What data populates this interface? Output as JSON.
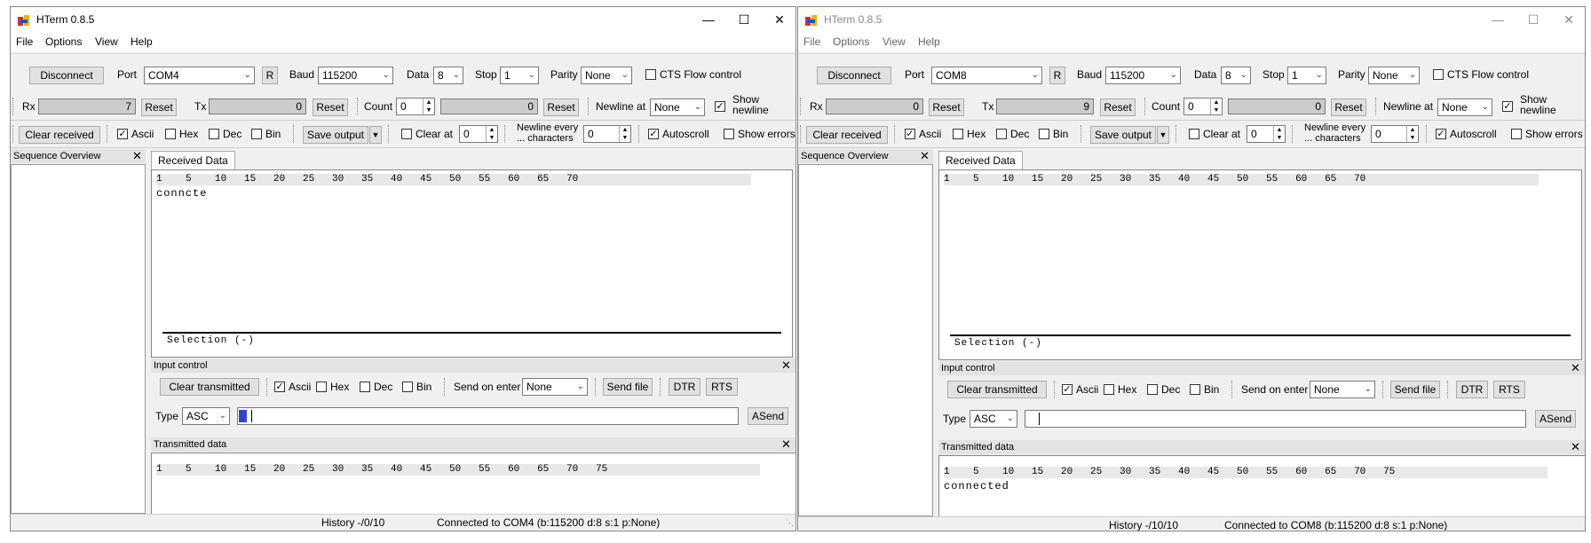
{
  "windows": [
    {
      "title": "HTerm 0.8.5",
      "menus": [
        "File",
        "Options",
        "View",
        "Help"
      ],
      "disconnect_label": "Disconnect",
      "port_label": "Port",
      "port_value": "COM4",
      "r_label": "R",
      "baud_label": "Baud",
      "baud_value": "115200",
      "data_label": "Data",
      "data_value": "8",
      "stop_label": "Stop",
      "stop_value": "1",
      "parity_label": "Parity",
      "parity_value": "None",
      "cts_label": "CTS Flow control",
      "rx_label": "Rx",
      "rx_value": "7",
      "tx_label": "Tx",
      "tx_value": "0",
      "reset_label": "Reset",
      "count_label": "Count",
      "count_value": "0",
      "count_field": "0",
      "newline_at_label": "Newline at",
      "newline_at_value": "None",
      "show_newline_label1": "Show",
      "show_newline_label2": "newline",
      "clear_received_label": "Clear received",
      "ascii_label": "Ascii",
      "hex_label": "Hex",
      "dec_label": "Dec",
      "bin_label": "Bin",
      "save_output_label": "Save output",
      "clear_at_label": "Clear at",
      "clear_at_value": "0",
      "newline_every_label1": "Newline every",
      "newline_every_label2": "... characters",
      "newline_every_value": "0",
      "autoscroll_label": "Autoscroll",
      "show_errors_label": "Show errors",
      "sequence_overview_label": "Sequence Overview",
      "received_tab_label": "Received Data",
      "ruler_recv": "1    5    10   15   20   25   30   35   40   45   50   55   60   65   70",
      "received_text": "conncte",
      "selection_label": "Selection (-)",
      "input_control_label": "Input control",
      "clear_transmitted_label": "Clear transmitted",
      "send_on_enter_label": "Send on enter",
      "send_on_enter_value": "None",
      "send_file_label": "Send file",
      "dtr_label": "DTR",
      "rts_label": "RTS",
      "type_label": "Type",
      "type_value": "ASC",
      "asend_label": "ASend",
      "transmitted_label": "Transmitted data",
      "ruler_tx": "1    5    10   15   20   25   30   35   40   45   50   55   60   65   70   75",
      "transmitted_text": "",
      "history_label": "History -/0/10",
      "status_label": "Connected to COM4 (b:115200 d:8 s:1 p:None)"
    },
    {
      "title": "HTerm 0.8.5",
      "menus": [
        "File",
        "Options",
        "View",
        "Help"
      ],
      "disconnect_label": "Disconnect",
      "port_label": "Port",
      "port_value": "COM8",
      "r_label": "R",
      "baud_label": "Baud",
      "baud_value": "115200",
      "data_label": "Data",
      "data_value": "8",
      "stop_label": "Stop",
      "stop_value": "1",
      "parity_label": "Parity",
      "parity_value": "None",
      "cts_label": "CTS Flow control",
      "rx_label": "Rx",
      "rx_value": "0",
      "tx_label": "Tx",
      "tx_value": "9",
      "reset_label": "Reset",
      "count_label": "Count",
      "count_value": "0",
      "count_field": "0",
      "newline_at_label": "Newline at",
      "newline_at_value": "None",
      "show_newline_label1": "Show",
      "show_newline_label2": "newline",
      "clear_received_label": "Clear received",
      "ascii_label": "Ascii",
      "hex_label": "Hex",
      "dec_label": "Dec",
      "bin_label": "Bin",
      "save_output_label": "Save output",
      "clear_at_label": "Clear at",
      "clear_at_value": "0",
      "newline_every_label1": "Newline every",
      "newline_every_label2": "... characters",
      "newline_every_value": "0",
      "autoscroll_label": "Autoscroll",
      "show_errors_label": "Show errors",
      "sequence_overview_label": "Sequence Overview",
      "received_tab_label": "Received Data",
      "ruler_recv": "1    5    10   15   20   25   30   35   40   45   50   55   60   65   70",
      "received_text": "",
      "selection_label": "Selection (-)",
      "input_control_label": "Input control",
      "clear_transmitted_label": "Clear transmitted",
      "send_on_enter_label": "Send on enter",
      "send_on_enter_value": "None",
      "send_file_label": "Send file",
      "dtr_label": "DTR",
      "rts_label": "RTS",
      "type_label": "Type",
      "type_value": "ASC",
      "asend_label": "ASend",
      "transmitted_label": "Transmitted data",
      "ruler_tx": "1    5    10   15   20   25   30   35   40   45   50   55   60   65   70   75",
      "transmitted_text": "connected",
      "history_label": "History -/10/10",
      "status_label": "Connected to COM8 (b:115200 d:8 s:1 p:None)"
    }
  ],
  "icons": {
    "minimize": "minimize-icon",
    "maximize": "maximize-icon",
    "close": "close-icon",
    "app": "hterm-app-icon"
  }
}
